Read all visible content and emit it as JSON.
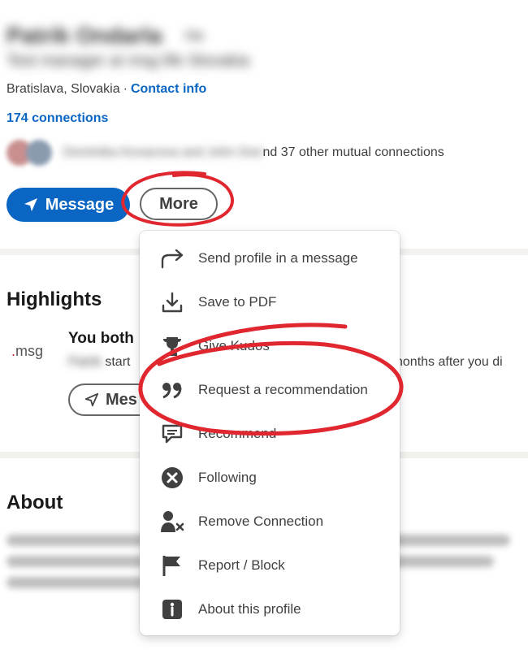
{
  "profile": {
    "name": "Patrik Ondarla",
    "pronoun": "He",
    "headline": "Test manager at msg life Slovakia",
    "location": "Bratislava, Slovakia",
    "contact_info_label": "Contact info",
    "connections": "174 connections",
    "mutual_blurred": "Dominika Kovacova and John Doe",
    "mutual_suffix": "nd 37 other mutual connections"
  },
  "actions": {
    "message_label": "Message",
    "more_label": "More"
  },
  "highlights": {
    "title": "Highlights",
    "logo_text": "msg",
    "item_title": "You both",
    "item_desc_blur": "Patrik",
    "item_desc_visible": "start",
    "item_desc_right": "nonths after you di",
    "message_label": "Mes"
  },
  "about": {
    "title": "About"
  },
  "menu": {
    "items": [
      {
        "label": "Send profile in a message",
        "icon": "share-arrow-icon"
      },
      {
        "label": "Save to PDF",
        "icon": "download-icon"
      },
      {
        "label": "Give Kudos",
        "icon": "trophy-icon"
      },
      {
        "label": "Request a recommendation",
        "icon": "quote-icon"
      },
      {
        "label": "Recommend",
        "icon": "speech-bubble-icon"
      },
      {
        "label": "Following",
        "icon": "close-circle-icon"
      },
      {
        "label": "Remove Connection",
        "icon": "remove-person-icon"
      },
      {
        "label": "Report / Block",
        "icon": "flag-icon"
      },
      {
        "label": "About this profile",
        "icon": "info-icon"
      }
    ]
  },
  "colors": {
    "brand_blue": "#0a66c2",
    "annotation_red": "#e0262f",
    "divider": "#f3f2ef"
  }
}
